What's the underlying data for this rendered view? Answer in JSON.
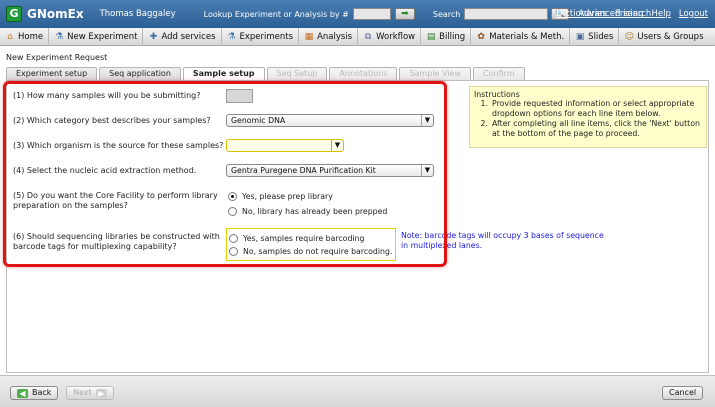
{
  "app": {
    "name": "GNomEx",
    "user": "Thomas Baggaley",
    "lookup_label": "Lookup Experiment or Analysis by #",
    "search_label": "Search",
    "advanced_search": "Advanced search",
    "links": [
      "Dictionaries",
      "Pricing",
      "Help",
      "Logout"
    ]
  },
  "menu": [
    {
      "label": "Home",
      "icon": "home-icon"
    },
    {
      "label": "New Experiment",
      "icon": "flask-icon"
    },
    {
      "label": "Add services",
      "icon": "plus-icon"
    },
    {
      "label": "Experiments",
      "icon": "flask-icon"
    },
    {
      "label": "Analysis",
      "icon": "chart-icon"
    },
    {
      "label": "Workflow",
      "icon": "workflow-icon"
    },
    {
      "label": "Billing",
      "icon": "billing-icon"
    },
    {
      "label": "Materials & Meth.",
      "icon": "materials-icon"
    },
    {
      "label": "Slides",
      "icon": "slides-icon"
    },
    {
      "label": "Users & Groups",
      "icon": "users-icon"
    }
  ],
  "page_title": "New Experiment Request",
  "tabs": [
    {
      "label": "Experiment setup",
      "state": "normal"
    },
    {
      "label": "Seq application",
      "state": "normal"
    },
    {
      "label": "Sample setup",
      "state": "active"
    },
    {
      "label": "Seq Setup",
      "state": "disabled"
    },
    {
      "label": "Annotations",
      "state": "disabled"
    },
    {
      "label": "Sample View",
      "state": "disabled"
    },
    {
      "label": "Confirm",
      "state": "disabled"
    }
  ],
  "questions": {
    "q1": "(1) How many samples will you be submitting?",
    "q2": "(2) Which category best describes your samples?",
    "q3": "(3) Which organism is the source for these samples?",
    "q4": "(4) Select the nucleic acid extraction method.",
    "q5_line1": "(5) Do you want the Core Facility to perform library",
    "q5_line2": "preparation on the samples?",
    "q6_line1": "(6) Should sequencing libraries be constructed with",
    "q6_line2": "barcode tags for multiplexing capability?"
  },
  "fields": {
    "sample_count": "",
    "category": "Genomic DNA",
    "organism": "",
    "extraction_method": "Gentra Puregene DNA Purification Kit"
  },
  "library_prep_options": [
    {
      "label": "Yes, please prep library",
      "checked": true
    },
    {
      "label": "No, library has already been prepped",
      "checked": false
    }
  ],
  "barcode_options": [
    {
      "label": "Yes, samples require barcoding",
      "checked": false
    },
    {
      "label": "No, samples do not require barcoding.",
      "checked": false
    }
  ],
  "barcode_note_line1": "Note: barcode tags will occupy 3 bases of sequence",
  "barcode_note_line2": "in multiplexed lanes.",
  "instructions": {
    "title": "Instructions",
    "items": [
      {
        "num": "1.",
        "text": "Provide requested information or select appropriate dropdown options for each line item below."
      },
      {
        "num": "2.",
        "text": "After completing all line items, click the 'Next' button at the bottom of the page to proceed."
      }
    ]
  },
  "buttons": {
    "back": "Back",
    "next": "Next",
    "cancel": "Cancel"
  }
}
